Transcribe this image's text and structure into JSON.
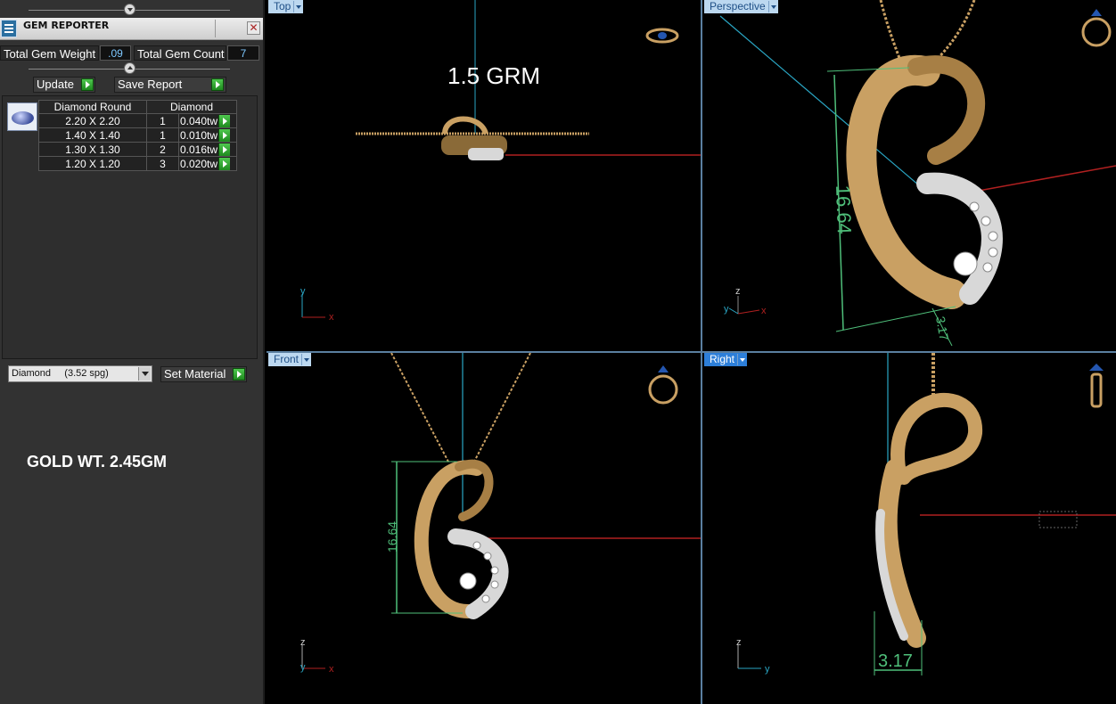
{
  "gem_reporter": {
    "title": "GEM REPORTER",
    "close_symbol": "✕",
    "total_gem_weight_label": "Total Gem Weight",
    "total_gem_weight_value": ".09",
    "total_gem_count_label": "Total Gem Count",
    "total_gem_count_value": "7",
    "update_label": "Update",
    "save_report_label": "Save Report",
    "table": {
      "columns": [
        "Diamond Round",
        "Diamond"
      ],
      "rows": [
        {
          "size": "2.20 X 2.20",
          "count": "1",
          "weight": "0.040tw"
        },
        {
          "size": "1.40 X 1.40",
          "count": "1",
          "weight": "0.010tw"
        },
        {
          "size": "1.30 X 1.30",
          "count": "2",
          "weight": "0.016tw"
        },
        {
          "size": "1.20 X 1.20",
          "count": "3",
          "weight": "0.020tw"
        }
      ]
    },
    "material_selected": "Diamond     (3.52 spg)",
    "set_material_label": "Set Material",
    "gold_weight_note": "GOLD WT. 2.45GM"
  },
  "viewports": {
    "top": {
      "label": "Top",
      "annotation": "1.5 GRM",
      "axis_x": "x",
      "axis_y": "y"
    },
    "perspective": {
      "label": "Perspective",
      "dimension_height": "16.64",
      "dimension_width": "3.17",
      "axis_x": "x",
      "axis_y": "y",
      "axis_z": "z"
    },
    "front": {
      "label": "Front",
      "dimension_height": "16.64",
      "axis_x": "x",
      "axis_y": "y",
      "axis_z": "z"
    },
    "right": {
      "label": "Right",
      "dimension_width": "3.17",
      "axis_y": "y",
      "axis_z": "z"
    }
  },
  "colors": {
    "gold": "#c9a063",
    "gold_dark": "#8a6a38",
    "white_gold": "#d8d8d8",
    "dimension": "#4fbf7a",
    "axis_blue": "#2aa6c4",
    "axis_red": "#b02020",
    "viewport_label": "#bcd8f0",
    "active_viewport_label": "#2d7fd9"
  }
}
